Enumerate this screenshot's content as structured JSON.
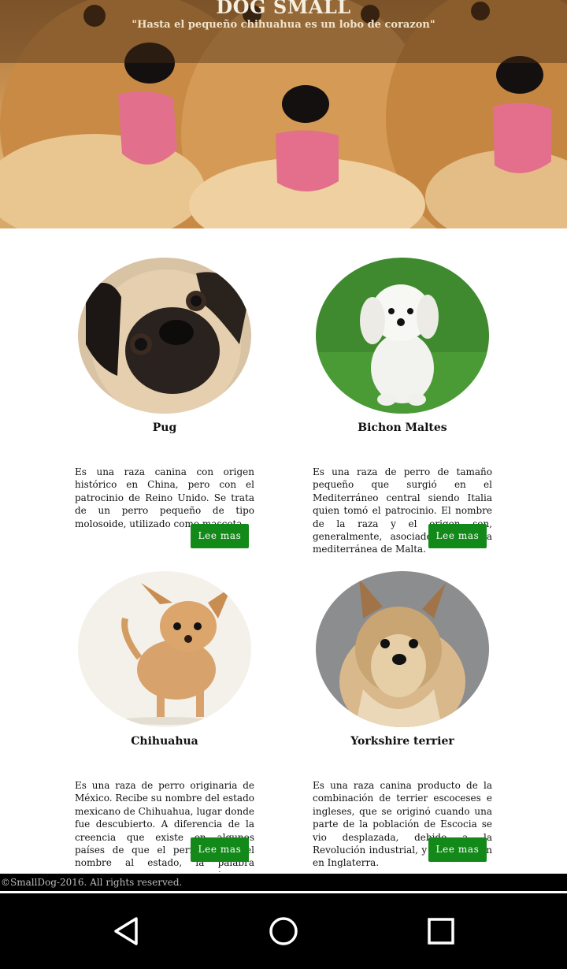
{
  "header": {
    "title": "DOG SMALL",
    "subtitle": "\"Hasta el pequeño chihuahua es un lobo de corazon\""
  },
  "cards": [
    {
      "name": "Pug",
      "description": "Es una raza canina con origen histórico en China, pero con el patrocinio de Reino Unido. Se trata de un perro pequeño de tipo molosoide, utilizado como mascota.",
      "button": "Lee mas"
    },
    {
      "name": "Bichon Maltes",
      "description": "Es una raza de perro de tamaño pequeño que surgió en el Mediterráneo central siendo Italia quien tomó el patrocinio. El nombre de la raza y el origen son, generalmente, asociados a la isla mediterránea de Malta.",
      "button": "Lee mas"
    },
    {
      "name": "Chihuahua",
      "description": "Es una raza de perro originaria de México. Recibe su nombre del estado mexicano de Chihuahua, lugar donde fue descubierto. A diferencia de la creencia que existe en algunos países de que el perro le dio el nombre al estado, la palabra Chihuahua significa lugar árido y arenoso en la lengua del pueblo",
      "button": "Lee mas"
    },
    {
      "name": "Yorkshire terrier",
      "description": "Es una raza canina producto de la combinación de terrier escoceses e ingleses, que se originó cuando una parte de la población de Escocia se vio desplazada, debido a la Revolución industrial, y se asentaron en Inglaterra.",
      "button": "Lee mas"
    }
  ],
  "footer": {
    "copyright": "©SmallDog-2016. All rights reserved."
  },
  "navigation": {
    "back": "back-icon",
    "home": "home-icon",
    "recents": "recents-icon"
  },
  "colors": {
    "button": "#13891a",
    "footer": "#000000"
  }
}
